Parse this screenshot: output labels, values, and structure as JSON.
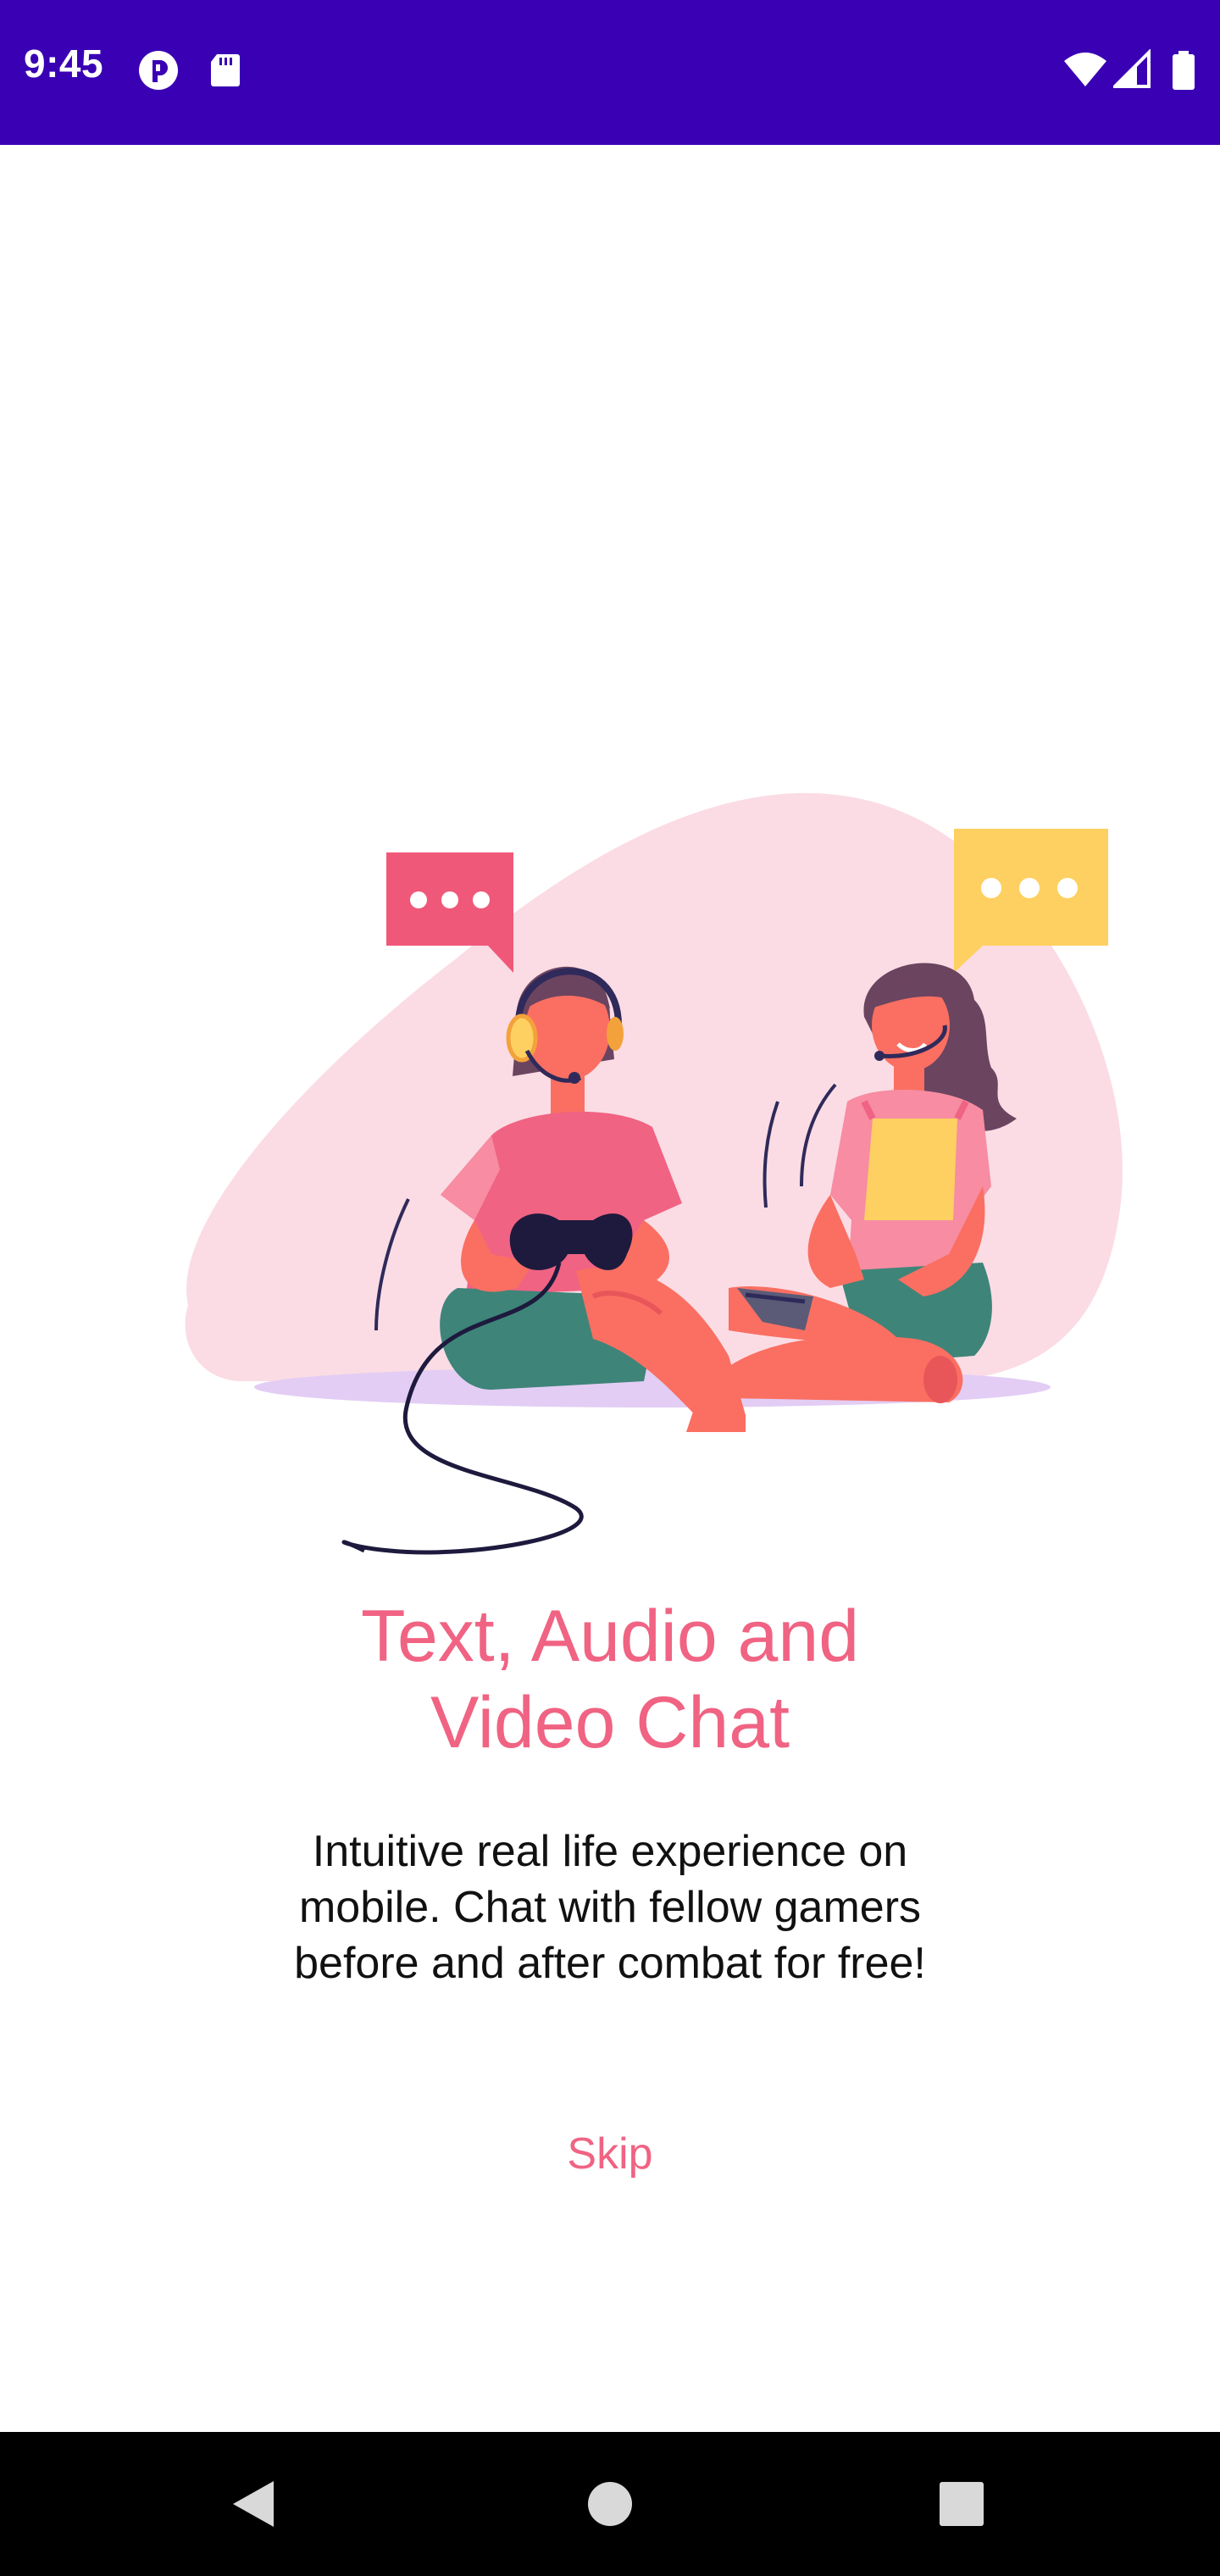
{
  "status_bar": {
    "time": "9:45",
    "background_color": "#3a00b4",
    "left_icons": [
      "assistant-icon",
      "sd-card-icon"
    ],
    "right_icons": [
      "wifi-icon",
      "cell-signal-icon",
      "battery-icon"
    ]
  },
  "onboarding": {
    "title_line1": "Text, Audio and",
    "title_line2": "Video Chat",
    "description": "Intuitive real life experience on mobile. Chat with fellow gamers before and after combat for free!",
    "skip_label": "Skip",
    "accent_color": "#f06383"
  },
  "navigation_bar": {
    "buttons": [
      "back-icon",
      "home-icon",
      "recents-icon"
    ]
  }
}
